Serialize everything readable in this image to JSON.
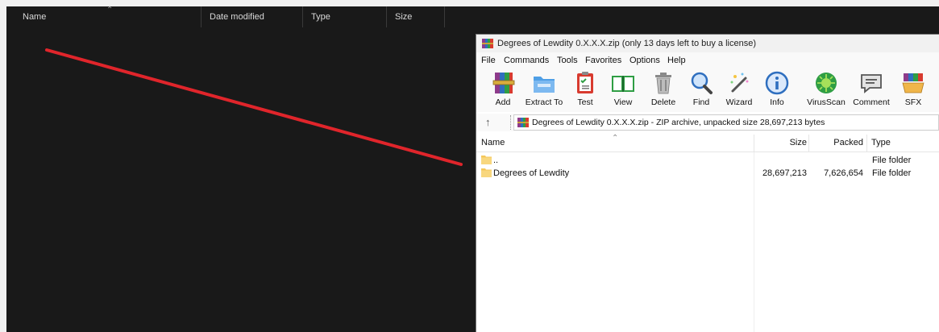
{
  "explorer": {
    "columns": {
      "name": "Name",
      "date": "Date modified",
      "type": "Type",
      "size": "Size"
    }
  },
  "winrar": {
    "title": "Degrees of Lewdity 0.X.X.X.zip (only 13 days left to buy a license)",
    "menu": [
      "File",
      "Commands",
      "Tools",
      "Favorites",
      "Options",
      "Help"
    ],
    "toolbar": [
      "Add",
      "Extract To",
      "Test",
      "View",
      "Delete",
      "Find",
      "Wizard",
      "Info",
      "VirusScan",
      "Comment",
      "SFX"
    ],
    "address": "Degrees of Lewdity 0.X.X.X.zip - ZIP archive, unpacked size 28,697,213 bytes",
    "columns": {
      "name": "Name",
      "size": "Size",
      "packed": "Packed",
      "type": "Type"
    },
    "rows": [
      {
        "name": "..",
        "size": "",
        "packed": "",
        "type": "File folder"
      },
      {
        "name": "Degrees of Lewdity",
        "size": "28,697,213",
        "packed": "7,626,654",
        "type": "File folder"
      }
    ]
  },
  "colors": {
    "explorer_bg": "#191919",
    "annotation_line": "#e0252b",
    "folder": "#f5c75a"
  }
}
